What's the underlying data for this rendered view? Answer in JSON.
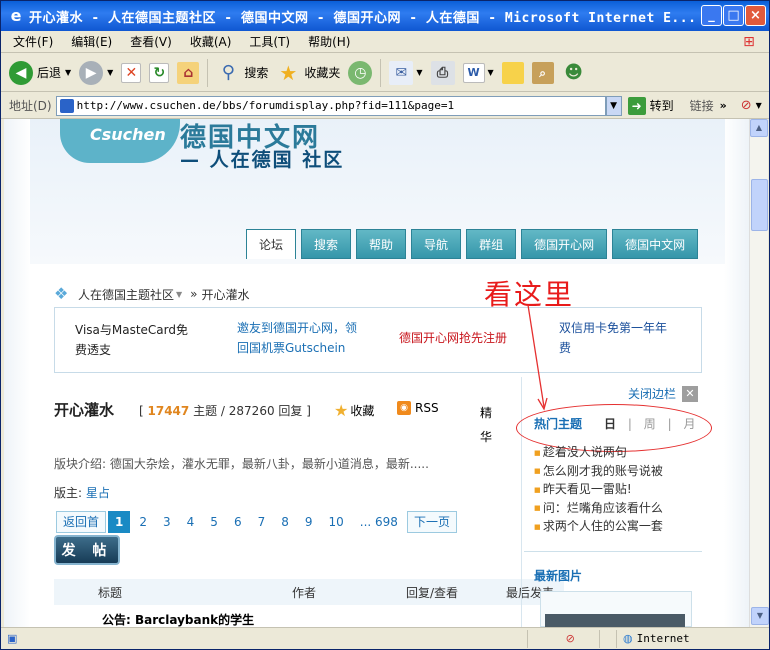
{
  "window": {
    "title": "开心灌水 - 人在德国主题社区 - 德国中文网 - 德国开心网 - 人在德国 - Microsoft Internet E...",
    "buttons": {
      "minimize": "_",
      "maximize": "□",
      "close": "×"
    }
  },
  "menubar": {
    "items": [
      "文件(F)",
      "编辑(E)",
      "查看(V)",
      "收藏(A)",
      "工具(T)",
      "帮助(H)"
    ]
  },
  "toolbar": {
    "back": "后退",
    "search": "搜索",
    "favorites": "收藏夹"
  },
  "addressbar": {
    "label": "地址(D)",
    "url": "http://www.csuchen.de/bbs/forumdisplay.php?fid=111&page=1",
    "go": "转到",
    "links": "链接"
  },
  "page": {
    "logo_text": "Csuchen",
    "site_title": "德国中文网",
    "site_subtitle": "— 人在德国 社区",
    "nav": [
      "论坛",
      "搜索",
      "帮助",
      "导航",
      "群组",
      "德国开心网",
      "德国中文网"
    ],
    "breadcrumb": {
      "root": "人在德国主题社区",
      "sep": "»",
      "current": "开心灌水"
    },
    "annotation": "看这里",
    "ads": [
      {
        "line1": "Visa与MasteCard免",
        "line2": "费透支",
        "color": "#222222"
      },
      {
        "line1": "邀友到德国开心网，领",
        "line2": "回国机票Gutschein",
        "color": "#1a6fb4"
      },
      {
        "line1": "德国开心网抢先注册",
        "line2": "",
        "color": "#c8161d"
      },
      {
        "line1": "双信用卡免第一年年",
        "line2": "费",
        "color": "#1a4f9b"
      }
    ],
    "forum": {
      "title": "开心灌水",
      "topics_num": "17447",
      "topics_label": "主题",
      "replies": "287260",
      "replies_label": "回复",
      "fav": "收藏",
      "rss": "RSS",
      "jinghua": "精华",
      "intro": "版块介绍: 德国大杂烩，灌水无罪，最新八卦，最新小道消息，最新.....",
      "moderator_label": "版主:",
      "moderator": "星占"
    },
    "pager": {
      "prev": "返回首",
      "pages": [
        "1",
        "2",
        "3",
        "4",
        "5",
        "6",
        "7",
        "8",
        "9",
        "10"
      ],
      "last": "... 698",
      "next": "下一页"
    },
    "post_button": "发 帖",
    "table": {
      "headers": {
        "title": "标题",
        "author": "作者",
        "reply_view": "回复/查看",
        "last_post": "最后发表"
      },
      "first_row": "公告: Barclaybank的学生"
    },
    "sidebar": {
      "close": "关闭边栏",
      "hot_title": "热门主题",
      "tabs": [
        "日",
        "周",
        "月"
      ],
      "hot_topics": [
        "趁着没人说两句",
        "怎么刚才我的账号说被",
        "昨天看见一雷贴!",
        "问：烂嘴角应该看什么",
        "求两个人住的公寓一套"
      ],
      "new_pics": "最新图片"
    }
  },
  "statusbar": {
    "zone": "Internet"
  }
}
